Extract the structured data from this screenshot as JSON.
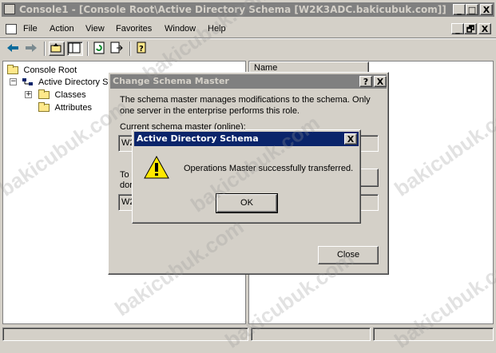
{
  "main_window": {
    "title": "Console1 - [Console Root\\Active Directory Schema [W2K3ADC.bakicubuk.com]]",
    "caption_buttons": [
      "_",
      "□",
      "X"
    ],
    "child_caption_buttons": [
      "_",
      "🗗",
      "X"
    ]
  },
  "menu": [
    "File",
    "Action",
    "View",
    "Favorites",
    "Window",
    "Help"
  ],
  "toolbar_icons": [
    "back-arrow-icon",
    "forward-arrow-icon",
    "up-folder-icon",
    "show-hide-tree-icon",
    "refresh-icon",
    "export-list-icon",
    "help-icon"
  ],
  "tree": {
    "root": "Console Root",
    "schema": "Active Directory Sc",
    "classes": "Classes",
    "attributes": "Attributes"
  },
  "list_header": {
    "name": "Name"
  },
  "change_schema_dialog": {
    "title": "Change Schema Master",
    "help_btn": "?",
    "close_btn": "X",
    "description": "The schema master manages modifications to the schema. Only one server in the enterprise performs this role.",
    "current_label": "Current schema master (online):",
    "current_value": "W2",
    "to_label": "To",
    "to_label2": "dor",
    "target_value": "W2",
    "close_button": "Close"
  },
  "message_dialog": {
    "title": "Active Directory Schema",
    "close_btn": "X",
    "message": "Operations Master successfully transferred.",
    "ok_button": "OK"
  },
  "watermark": "bakicubuk.com",
  "colors": {
    "active_title": "#0a246a",
    "inactive_title": "#808080",
    "face": "#d4d0c8"
  }
}
